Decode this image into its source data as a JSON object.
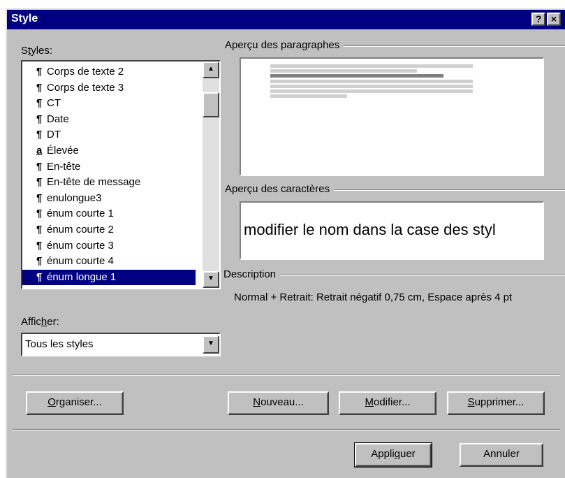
{
  "dialog": {
    "title": "Style",
    "help_label": "?",
    "close_label": "×"
  },
  "styles_panel": {
    "label": "Styles:",
    "items": [
      {
        "mark": "¶",
        "label": "Corps de texte 2"
      },
      {
        "mark": "¶",
        "label": "Corps de texte 3"
      },
      {
        "mark": "¶",
        "label": "CT"
      },
      {
        "mark": "¶",
        "label": "Date"
      },
      {
        "mark": "¶",
        "label": "DT"
      },
      {
        "mark": "a",
        "label": "Élevée"
      },
      {
        "mark": "¶",
        "label": "En-tête"
      },
      {
        "mark": "¶",
        "label": "En-tête de message"
      },
      {
        "mark": "¶",
        "label": "enulongue3"
      },
      {
        "mark": "¶",
        "label": "énum courte 1"
      },
      {
        "mark": "¶",
        "label": "énum courte 2"
      },
      {
        "mark": "¶",
        "label": "énum courte 3"
      },
      {
        "mark": "¶",
        "label": "énum courte 4"
      },
      {
        "mark": "¶",
        "label": "énum longue 1"
      }
    ],
    "selected_index": 13
  },
  "afficher": {
    "label": "Afficher:",
    "value": "Tous les styles"
  },
  "preview": {
    "paragraphs_label": "Aperçu des paragraphes",
    "characters_label": "Aperçu des caractères",
    "characters_sample": "modifier le nom dans la case des styl"
  },
  "description": {
    "label": "Description",
    "text": "Normal + Retrait:  Retrait négatif  0,75 cm, Espace après 4 pt"
  },
  "buttons": {
    "organiser": "Organiser...",
    "nouveau": "Nouveau...",
    "modifier": "Modifier...",
    "supprimer": "Supprimer...",
    "appliquer": "Appliquer",
    "annuler": "Annuler"
  }
}
